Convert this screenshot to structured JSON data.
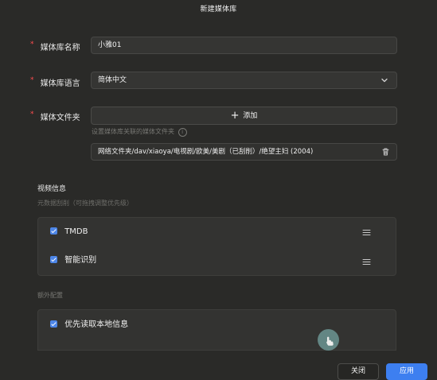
{
  "dialog": {
    "title": "新建媒体库"
  },
  "form": {
    "library_name": {
      "label": "媒体库名称",
      "value": "小雅01"
    },
    "library_language": {
      "label": "媒体库语言",
      "value": "简体中文"
    },
    "library_folder": {
      "label": "媒体文件夹",
      "add_label": "添加",
      "hint": "设置媒体库关联的媒体文件夹",
      "path": "网络文件夹/dav/xiaoya/电视剧/欧美/美剧（已刮削）/绝望主妇 (2004)"
    }
  },
  "video_info": {
    "title": "视频信息",
    "metadata_hint": "元数据刮削（可拖拽调整优先级）",
    "sources": [
      {
        "label": "TMDB",
        "checked": true
      },
      {
        "label": "智能识别",
        "checked": true
      }
    ]
  },
  "extra_config": {
    "title": "额外配置",
    "options": [
      {
        "label": "优先读取本地信息",
        "checked": true
      }
    ]
  },
  "buttons": {
    "close": "关闭",
    "apply": "应用"
  },
  "colors": {
    "background": "#2a2a28",
    "panel": "#333331",
    "accent": "#3d7ff0",
    "required": "#ff4d4f",
    "cursor_bubble": "#668b89"
  },
  "icons": {
    "chevron": "chevron-down-icon",
    "plus": "plus-icon",
    "info": "info-icon",
    "delete": "trash-icon",
    "drag": "drag-handle-icon",
    "cursor": "pointer-cursor-icon"
  }
}
